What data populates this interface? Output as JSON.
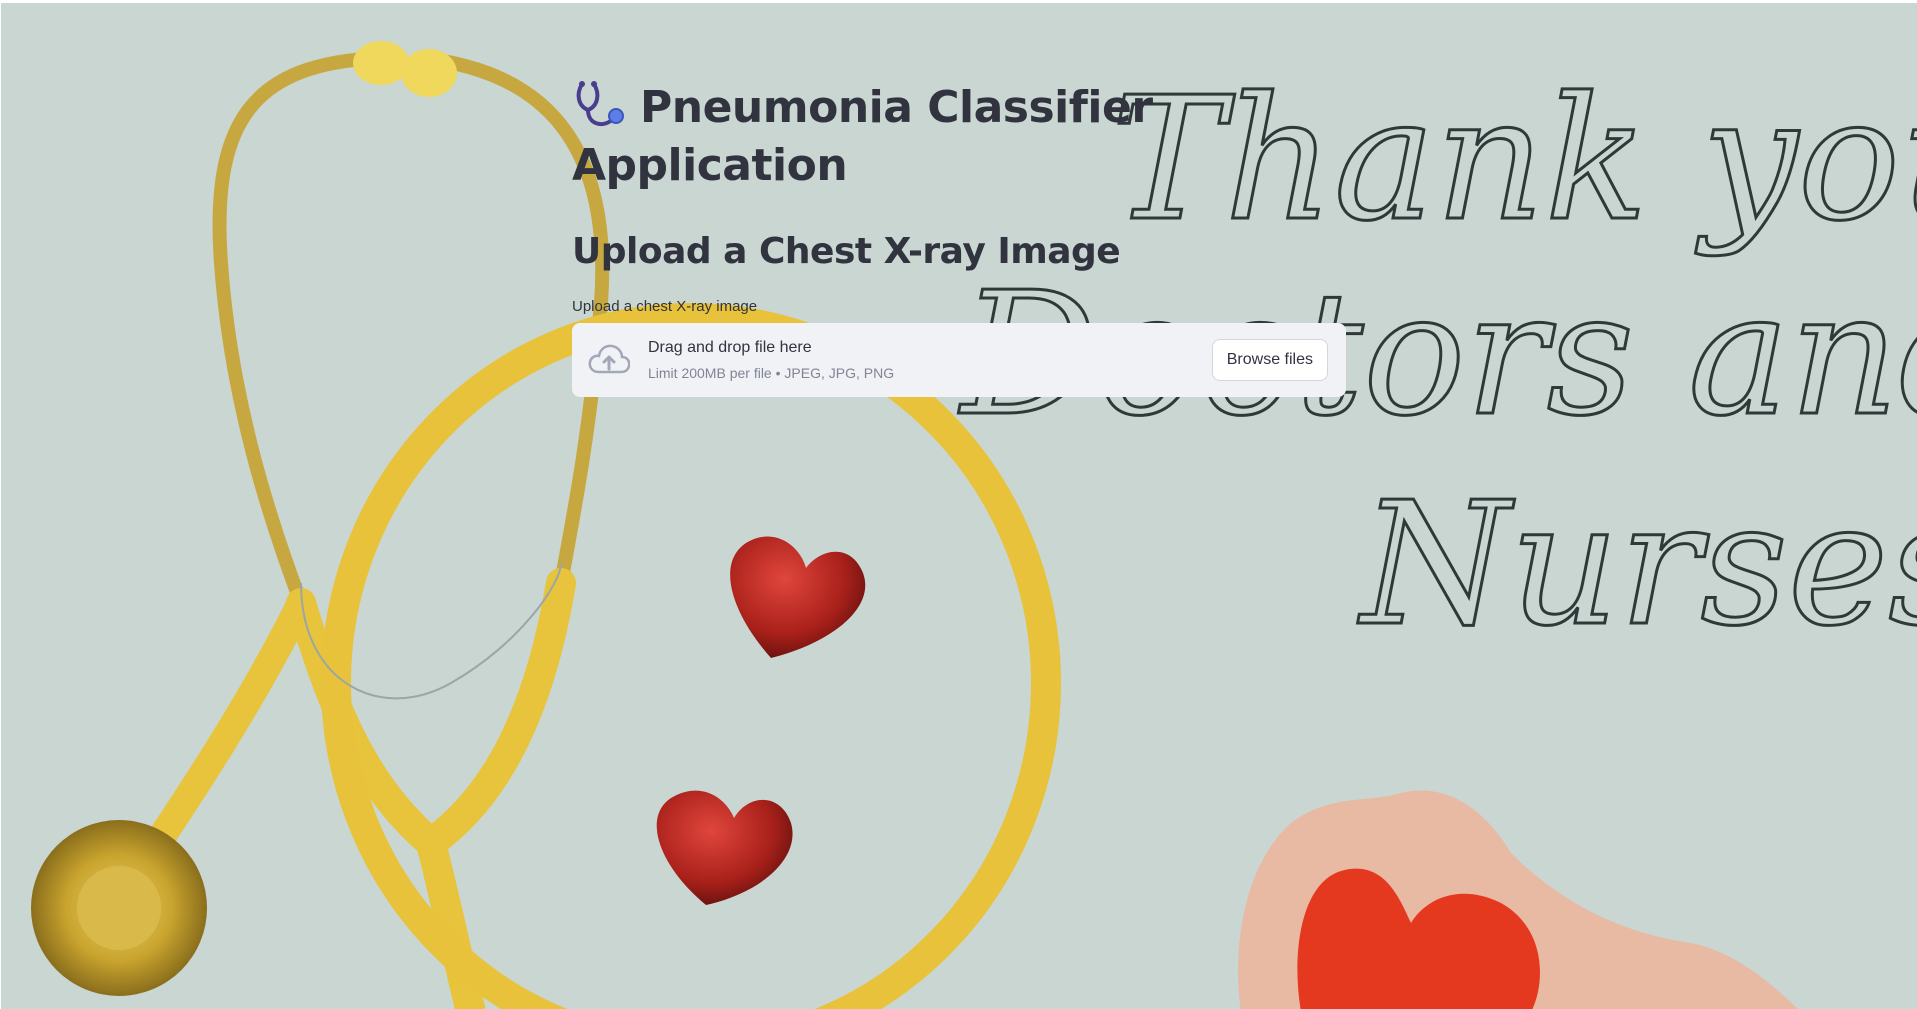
{
  "header": {
    "title": "Pneumonia Classifier Application",
    "title_icon": "stethoscope-icon"
  },
  "main": {
    "subheader": "Upload a Chest X-ray Image",
    "uploader": {
      "label": "Upload a chest X-ray image",
      "drop_text": "Drag and drop file here",
      "limit_text": "Limit 200MB per file • JPEG, JPG, PNG",
      "browse_label": "Browse files",
      "icon": "cloud-upload-icon"
    }
  },
  "background": {
    "line1": "Thank you",
    "line2": "Doctors and",
    "line3": "Nurses"
  },
  "colors": {
    "text": "#31333f",
    "dropzone_bg": "#f0f2f6",
    "muted": "#808495",
    "stethoscope": "#e8c23a",
    "heart": "#b8201c"
  }
}
